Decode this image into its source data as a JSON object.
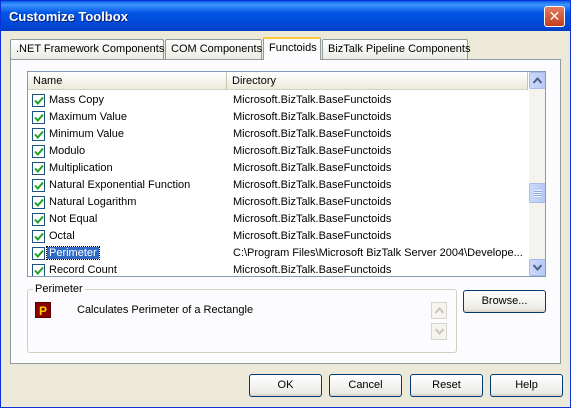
{
  "window": {
    "title": "Customize Toolbox",
    "close_glyph": "✕"
  },
  "tabs": [
    {
      "label": ".NET Framework Components"
    },
    {
      "label": "COM Components"
    },
    {
      "label": "Functoids"
    },
    {
      "label": "BizTalk Pipeline Components"
    }
  ],
  "active_tab": "Functoids",
  "list": {
    "columns": {
      "name": "Name",
      "directory": "Directory"
    },
    "rows": [
      {
        "name": "Mass Copy",
        "directory": "Microsoft.BizTalk.BaseFunctoids",
        "checked": true
      },
      {
        "name": "Maximum Value",
        "directory": "Microsoft.BizTalk.BaseFunctoids",
        "checked": true
      },
      {
        "name": "Minimum Value",
        "directory": "Microsoft.BizTalk.BaseFunctoids",
        "checked": true
      },
      {
        "name": "Modulo",
        "directory": "Microsoft.BizTalk.BaseFunctoids",
        "checked": true
      },
      {
        "name": "Multiplication",
        "directory": "Microsoft.BizTalk.BaseFunctoids",
        "checked": true
      },
      {
        "name": "Natural Exponential Function",
        "directory": "Microsoft.BizTalk.BaseFunctoids",
        "checked": true
      },
      {
        "name": "Natural Logarithm",
        "directory": "Microsoft.BizTalk.BaseFunctoids",
        "checked": true
      },
      {
        "name": "Not Equal",
        "directory": "Microsoft.BizTalk.BaseFunctoids",
        "checked": true
      },
      {
        "name": "Octal",
        "directory": "Microsoft.BizTalk.BaseFunctoids",
        "checked": true
      },
      {
        "name": "Perimeter",
        "directory": "C:\\Program Files\\Microsoft BizTalk Server 2004\\Develope...",
        "checked": true,
        "selected": true
      },
      {
        "name": "Record Count",
        "directory": "Microsoft.BizTalk.BaseFunctoids",
        "checked": true
      }
    ]
  },
  "details": {
    "group_label": "Perimeter",
    "icon_letter": "P",
    "description": "Calculates Perimeter of a Rectangle"
  },
  "buttons": {
    "browse": "Browse...",
    "ok": "OK",
    "cancel": "Cancel",
    "reset": "Reset",
    "help": "Help"
  },
  "colors": {
    "titlebar": "#0054e3",
    "selection": "#316ac5",
    "dialog_bg": "#ece9d8",
    "active_tab_accent": "#ffc83c"
  },
  "icons": [
    "close-icon",
    "checkbox-checked-icon",
    "scroll-up-icon",
    "scroll-down-icon",
    "functoid-icon"
  ]
}
